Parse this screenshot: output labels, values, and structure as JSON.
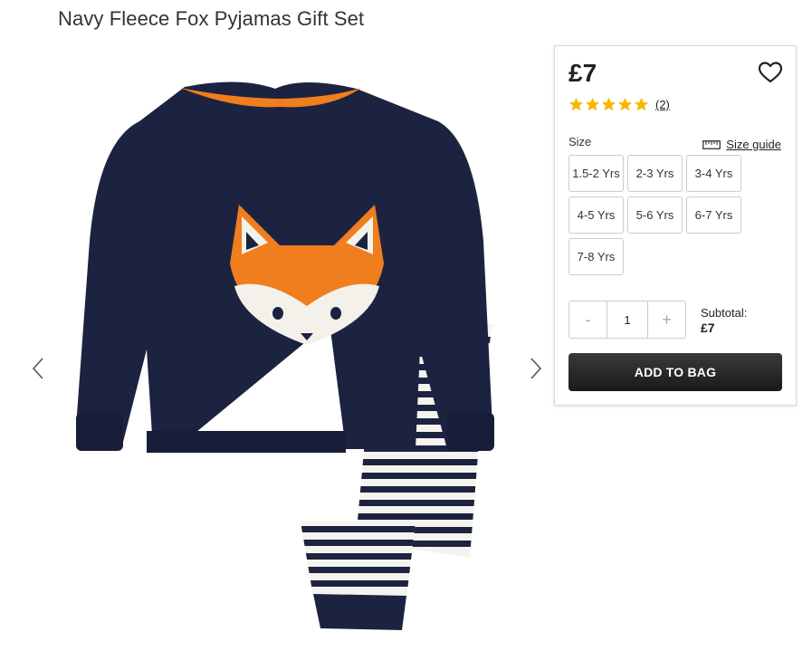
{
  "product": {
    "title": "Navy Fleece Fox Pyjamas Gift Set",
    "price": "£7",
    "rating": {
      "stars": 5,
      "max": 5,
      "review_count": "(2)"
    },
    "size_label": "Size",
    "size_guide_label": "Size guide",
    "sizes": [
      "1.5-2 Yrs",
      "2-3 Yrs",
      "3-4 Yrs",
      "4-5 Yrs",
      "5-6 Yrs",
      "6-7 Yrs",
      "7-8 Yrs"
    ],
    "quantity": {
      "minus": "-",
      "value": "1",
      "plus": "+"
    },
    "subtotal_label": "Subtotal:",
    "subtotal_value": "£7",
    "add_to_bag_label": "ADD TO BAG"
  },
  "colors": {
    "navy": "#1c2340",
    "orange": "#f07d1e",
    "star": "#f5b800",
    "button_dark": "#222222"
  },
  "icons": [
    "chevron-left-icon",
    "chevron-right-icon",
    "heart-icon",
    "star-icon",
    "ruler-icon"
  ]
}
